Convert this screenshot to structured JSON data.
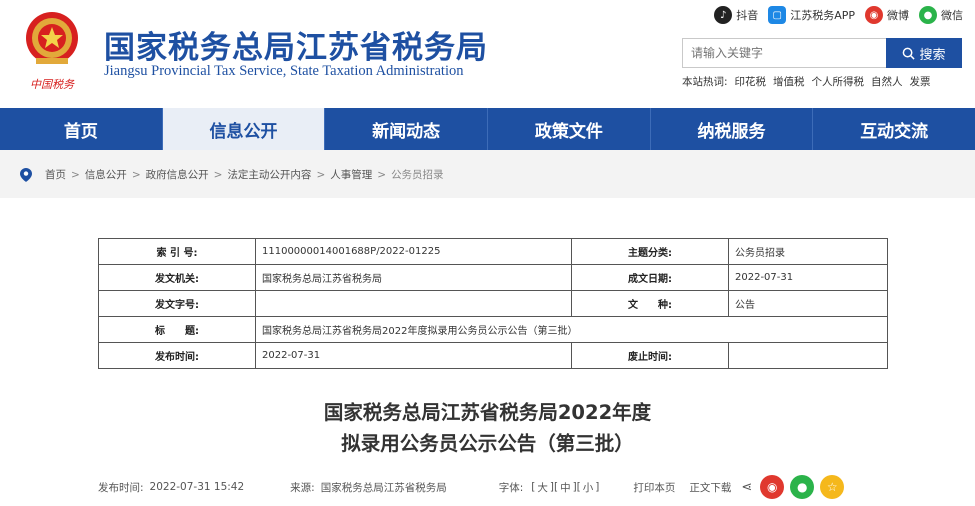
{
  "header": {
    "title": "国家税务总局江苏省税务局",
    "subtitle": "Jiangsu Provincial Tax Service, State Taxation Administration",
    "emblem_text": "中国税务",
    "top_links": [
      {
        "label": "抖音",
        "icon": "douyin-icon",
        "color": "#222222"
      },
      {
        "label": "江苏税务APP",
        "icon": "app-icon",
        "color": "#1e88e5"
      },
      {
        "label": "微博",
        "icon": "weibo-icon",
        "color": "#e0382e"
      },
      {
        "label": "微信",
        "icon": "wechat-icon",
        "color": "#2bb34a"
      }
    ],
    "search": {
      "placeholder": "请输入关键字",
      "button_label": "搜索"
    },
    "hotwords": {
      "label": "本站热词:",
      "items": [
        "印花税",
        "增值税",
        "个人所得税",
        "自然人",
        "发票"
      ]
    }
  },
  "nav": {
    "items": [
      "首页",
      "信息公开",
      "新闻动态",
      "政策文件",
      "纳税服务",
      "互动交流"
    ],
    "active_index": 1
  },
  "breadcrumb": {
    "items": [
      "首页",
      "信息公开",
      "政府信息公开",
      "法定主动公开内容",
      "人事管理"
    ],
    "current": "公务员招录"
  },
  "meta_table": {
    "rows": [
      {
        "l1": "索 引 号:",
        "v1": "11100000014001688P/2022-01225",
        "l2": "主题分类:",
        "v2": "公务员招录"
      },
      {
        "l1": "发文机关:",
        "v1": "国家税务总局江苏省税务局",
        "l2": "成文日期:",
        "v2": "2022-07-31"
      },
      {
        "l1": "发文字号:",
        "v1": "",
        "l2": "文　　种:",
        "v2": "公告"
      },
      {
        "l1": "标　　题:",
        "v1": "国家税务总局江苏省税务局2022年度拟录用公务员公示公告（第三批）",
        "full": true
      },
      {
        "l1": "发布时间:",
        "v1": "2022-07-31",
        "l2": "废止时间:",
        "v2": ""
      }
    ]
  },
  "article": {
    "title_line1": "国家税务总局江苏省税务局2022年度",
    "title_line2": "拟录用公务员公示公告（第三批）",
    "publish_label": "发布时间:",
    "publish_time": "2022-07-31 15:42",
    "source_label": "来源:",
    "source": "国家税务总局江苏省税务局",
    "font_label": "字体:",
    "font_large": "大",
    "font_medium": "中",
    "font_small": "小",
    "print_label": "打印本页",
    "download_label": "正文下载"
  },
  "colors": {
    "brand_blue": "#1e50a2",
    "nav_active_bg": "#e9eef6",
    "weibo_red": "#e0382e",
    "wechat_green": "#2bb34a",
    "favorite_yellow": "#f5b81c"
  }
}
